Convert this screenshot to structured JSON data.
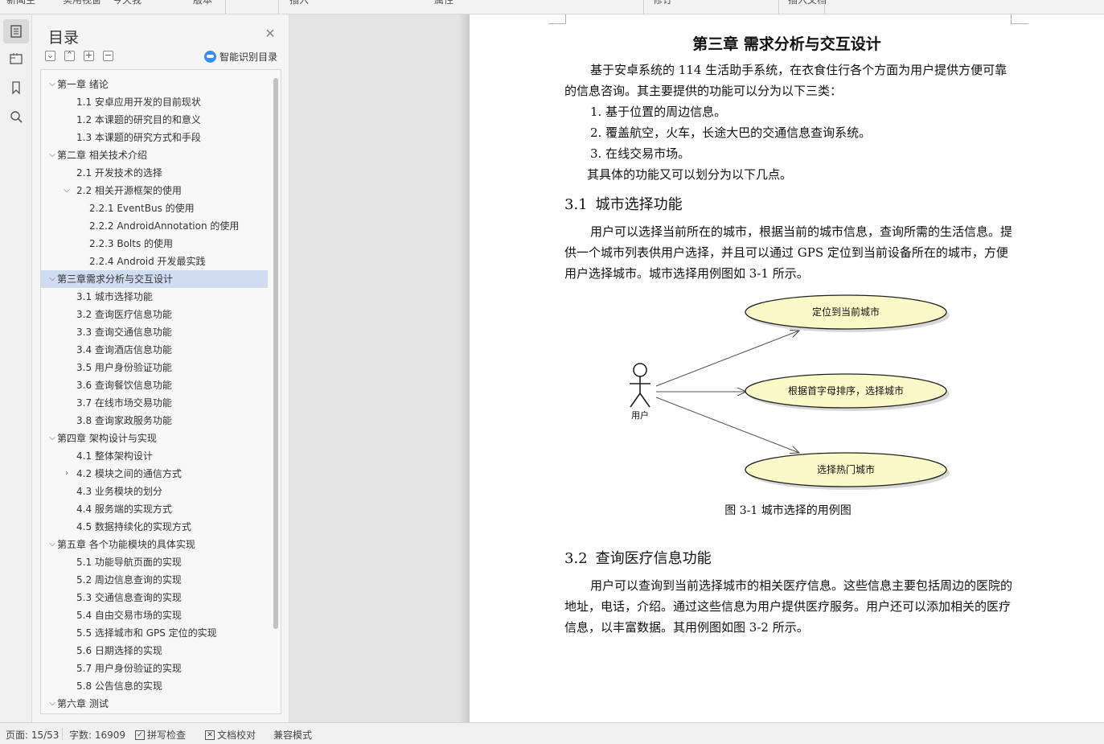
{
  "toolbar": {
    "items": [
      "新闻主",
      "实用视窗",
      "今天我",
      "版本",
      "插入",
      "属性",
      "修订",
      "插入文档"
    ]
  },
  "rail": {
    "icons": [
      "toc-icon",
      "navigation-icon",
      "bookmark-icon",
      "search-icon"
    ]
  },
  "toc": {
    "title": "目录",
    "smart_label": "智能识别目录",
    "items": [
      {
        "label": "第一章  绪论",
        "level": 1,
        "chevron": "down",
        "selected": false
      },
      {
        "label": "1.1  安卓应用开发的目前现状",
        "level": 2,
        "chevron": "",
        "selected": false
      },
      {
        "label": "1.2  本课题的研究目的和意义",
        "level": 2,
        "chevron": "",
        "selected": false
      },
      {
        "label": "1.3  本课题的研究方式和手段",
        "level": 2,
        "chevron": "",
        "selected": false
      },
      {
        "label": "第二章  相关技术介绍",
        "level": 1,
        "chevron": "down",
        "selected": false
      },
      {
        "label": "2.1  开发技术的选择",
        "level": 2,
        "chevron": "",
        "selected": false
      },
      {
        "label": "2.2  相关开源框架的使用",
        "level": 2,
        "chevron": "down",
        "selected": false
      },
      {
        "label": "2.2.1 EventBus  的使用",
        "level": 3,
        "chevron": "",
        "selected": false
      },
      {
        "label": "2.2.2 AndroidAnnotation  的使用",
        "level": 3,
        "chevron": "",
        "selected": false
      },
      {
        "label": "2.2.3 Bolts  的使用",
        "level": 3,
        "chevron": "",
        "selected": false
      },
      {
        "label": "2.2.4 Android  开发最实践",
        "level": 3,
        "chevron": "",
        "selected": false
      },
      {
        "label": "第三章需求分析与交互设计",
        "level": 1,
        "chevron": "down",
        "selected": true
      },
      {
        "label": "3.1  城市选择功能",
        "level": 2,
        "chevron": "",
        "selected": false
      },
      {
        "label": "3.2  查询医疗信息功能",
        "level": 2,
        "chevron": "",
        "selected": false
      },
      {
        "label": "3.3  查询交通信息功能",
        "level": 2,
        "chevron": "",
        "selected": false
      },
      {
        "label": "3.4  查询酒店信息功能",
        "level": 2,
        "chevron": "",
        "selected": false
      },
      {
        "label": "3.5  用户身份验证功能",
        "level": 2,
        "chevron": "",
        "selected": false
      },
      {
        "label": "3.6  查询餐饮信息功能",
        "level": 2,
        "chevron": "",
        "selected": false
      },
      {
        "label": "3.7  在线市场交易功能",
        "level": 2,
        "chevron": "",
        "selected": false
      },
      {
        "label": "3.8  查询家政服务功能",
        "level": 2,
        "chevron": "",
        "selected": false
      },
      {
        "label": "第四章  架构设计与实现",
        "level": 1,
        "chevron": "down",
        "selected": false
      },
      {
        "label": "4.1  整体架构设计",
        "level": 2,
        "chevron": "",
        "selected": false
      },
      {
        "label": "4.2  模块之间的通信方式",
        "level": 2,
        "chevron": "right",
        "selected": false
      },
      {
        "label": "4.3  业务模块的划分",
        "level": 2,
        "chevron": "",
        "selected": false
      },
      {
        "label": "4.4  服务端的实现方式",
        "level": 2,
        "chevron": "",
        "selected": false
      },
      {
        "label": "4.5  数据持续化的实现方式",
        "level": 2,
        "chevron": "",
        "selected": false
      },
      {
        "label": "第五章  各个功能模块的具体实现",
        "level": 1,
        "chevron": "down",
        "selected": false
      },
      {
        "label": "5.1  功能导航页面的实现",
        "level": 2,
        "chevron": "",
        "selected": false
      },
      {
        "label": "5.2  周边信息查询的实现",
        "level": 2,
        "chevron": "",
        "selected": false
      },
      {
        "label": "5.3  交通信息查询的实现",
        "level": 2,
        "chevron": "",
        "selected": false
      },
      {
        "label": "5.4  自由交易市场的实现",
        "level": 2,
        "chevron": "",
        "selected": false
      },
      {
        "label": "5.5  选择城市和 GPS  定位的实现",
        "level": 2,
        "chevron": "",
        "selected": false
      },
      {
        "label": "5.6  日期选择的实现",
        "level": 2,
        "chevron": "",
        "selected": false
      },
      {
        "label": "5.7  用户身份验证的实现",
        "level": 2,
        "chevron": "",
        "selected": false
      },
      {
        "label": "5.8 公告信息的实现",
        "level": 2,
        "chevron": "",
        "selected": false
      },
      {
        "label": "第六章  测试",
        "level": 1,
        "chevron": "down",
        "selected": false
      }
    ]
  },
  "document": {
    "chapter_title": "第三章  需求分析与交互设计",
    "intro": "基于安卓系统的 114 生活助手系统，在衣食住行各个方面为用户提供方便可靠的信息咨询。其主要提供的功能可以分为以下三类：",
    "list": [
      "1.  基于位置的周边信息。",
      "2.  覆盖航空，火车，长途大巴的交通信息查询系统。",
      "3.  在线交易市场。"
    ],
    "after_list": "其具体的功能又可以划分为以下几点。",
    "section1_num": "3.1",
    "section1_title": "城市选择功能",
    "section1_text": "用户可以选择当前所在的城市，根据当前的城市信息，查询所需的生活信息。提供一个城市列表供用户选择，并且可以通过 GPS 定位到当前设备所在的城市，方便用户选择城市。城市选择用例图如 3-1 所示。",
    "diagram": {
      "actor": "用户",
      "use_cases": [
        "定位到当前城市",
        "根据首字母排序，选择城市",
        "选择热门城市"
      ]
    },
    "figure_caption": "图 3-1  城市选择的用例图",
    "section2_num": "3.2",
    "section2_title": "查询医疗信息功能",
    "section2_text": "用户可以查询到当前选择城市的相关医疗信息。这些信息主要包括周边的医院的地址，电话，介绍。通过这些信息为用户提供医疗服务。用户还可以添加相关的医疗信息，以丰富数据。其用例图如图 3-2 所示。"
  },
  "status": {
    "page": "页面: 15/53",
    "words": "字数: 16909",
    "spell_check": "拼写检查",
    "doc_proof": "文档校对",
    "compat_mode": "兼容模式"
  },
  "colors": {
    "selected_row": "#cfdcf1",
    "use_case_fill": "#fbf9c8",
    "smart_icon": "#3c8cf0"
  }
}
